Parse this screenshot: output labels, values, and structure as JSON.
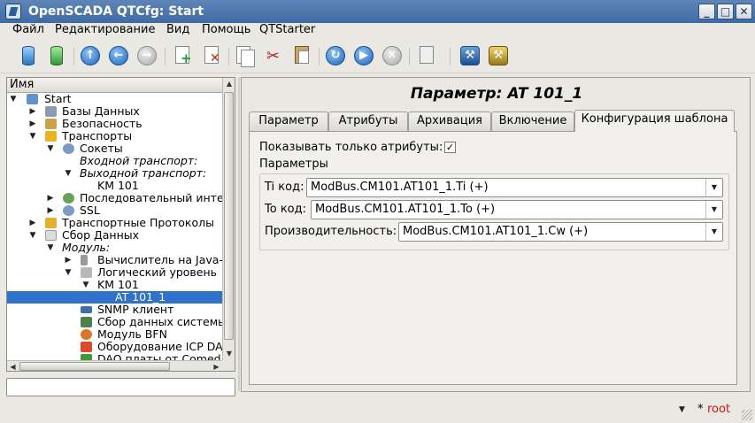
{
  "window": {
    "title": "OpenSCADA QTCfg: Start",
    "min_glyph": "_",
    "max_glyph": "□",
    "close_glyph": "✕"
  },
  "menu": [
    "Файл",
    "Редактирование",
    "Вид",
    "Помощь",
    "QTStarter"
  ],
  "toolbar": {
    "icons": [
      "db-load-icon",
      "db-save-icon",
      "up-icon",
      "back-icon",
      "forward-icon",
      "add-item-icon",
      "delete-item-icon",
      "copy-icon",
      "cut-icon",
      "paste-icon",
      "refresh-icon",
      "start-icon",
      "stop-icon",
      "manual-icon",
      "qtcfg-icon",
      "uiprj-icon"
    ]
  },
  "tree": {
    "header": "Имя",
    "items": [
      {
        "label": "Start",
        "italic": false,
        "selected": false
      },
      {
        "label": "Базы Данных",
        "italic": false,
        "selected": false
      },
      {
        "label": "Безопасность",
        "italic": false,
        "selected": false
      },
      {
        "label": "Транспорты",
        "italic": false,
        "selected": false
      },
      {
        "label": "Сокеты",
        "italic": false,
        "selected": false
      },
      {
        "label": "Входной транспорт:",
        "italic": true,
        "selected": false
      },
      {
        "label": "Выходной транспорт:",
        "italic": true,
        "selected": false
      },
      {
        "label": "KM 101",
        "italic": false,
        "selected": false
      },
      {
        "label": "Последовательный инте",
        "italic": false,
        "selected": false
      },
      {
        "label": "SSL",
        "italic": false,
        "selected": false
      },
      {
        "label": "Транспортные Протоколы",
        "italic": false,
        "selected": false
      },
      {
        "label": "Сбор Данных",
        "italic": false,
        "selected": false
      },
      {
        "label": "Модуль:",
        "italic": true,
        "selected": false
      },
      {
        "label": "Вычислитель на Java-",
        "italic": false,
        "selected": false
      },
      {
        "label": "Логический уровень",
        "italic": false,
        "selected": false
      },
      {
        "label": "KM 101",
        "italic": false,
        "selected": false
      },
      {
        "label": "AT 101_1",
        "italic": false,
        "selected": true
      },
      {
        "label": "SNMP клиент",
        "italic": false,
        "selected": false
      },
      {
        "label": "Сбор данных системы",
        "italic": false,
        "selected": false
      },
      {
        "label": "Модуль BFN",
        "italic": false,
        "selected": false
      },
      {
        "label": "Оборудование ICP DA",
        "italic": false,
        "selected": false
      },
      {
        "label": "DAQ платы от Comed",
        "italic": false,
        "selected": false
      }
    ]
  },
  "main": {
    "title": "Параметр: AT 101_1",
    "tabs": [
      "Параметр",
      "Атрибуты",
      "Архивация",
      "Включение",
      "Конфигурация шаблона"
    ],
    "active_tab": "Конфигурация шаблона",
    "show_only_attrs_label": "Показывать только атрибуты:",
    "show_only_attrs_checked": "✓",
    "params_label": "Параметры",
    "fields": [
      {
        "label": "Ti код:",
        "value": "ModBus.CM101.AT101_1.Ti (+)"
      },
      {
        "label": "To код:",
        "value": "ModBus.CM101.AT101_1.To (+)"
      },
      {
        "label": "Производительность:",
        "value": "ModBus.CM101.AT101_1.Cw (+)"
      }
    ]
  },
  "status": {
    "modified_marker": "*",
    "user": "root"
  }
}
